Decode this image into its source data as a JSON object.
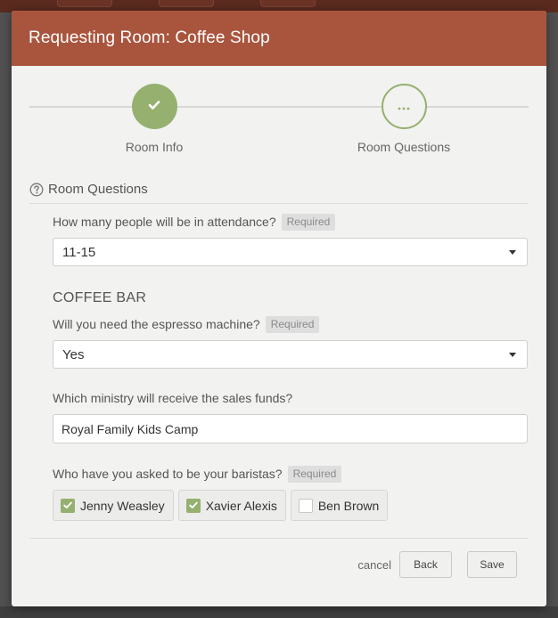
{
  "modal": {
    "title": "Requesting Room: Coffee Shop"
  },
  "stepper": {
    "steps": [
      {
        "label": "Room Info",
        "state": "completed",
        "icon": "check-icon"
      },
      {
        "label": "Room Questions",
        "state": "current",
        "icon": "ellipsis-icon"
      }
    ]
  },
  "section": {
    "title": "Room Questions",
    "icon": "help-circle-icon"
  },
  "questions": {
    "attendance": {
      "label": "How many people will be in attendance?",
      "badge": "Required",
      "value": "11-15"
    },
    "group_heading": "COFFEE BAR",
    "espresso": {
      "label": "Will you need the espresso machine?",
      "badge": "Required",
      "value": "Yes"
    },
    "ministry": {
      "label": "Which ministry will receive the sales funds?",
      "value": "Royal Family Kids Camp"
    },
    "baristas": {
      "label": "Who have you asked to be your baristas?",
      "badge": "Required",
      "options": [
        {
          "label": "Jenny Weasley",
          "checked": true
        },
        {
          "label": "Xavier Alexis",
          "checked": true
        },
        {
          "label": "Ben Brown",
          "checked": false
        }
      ]
    }
  },
  "footer": {
    "cancel_label": "cancel",
    "back_label": "Back",
    "save_label": "Save"
  },
  "colors": {
    "header": "#a9553e",
    "accent": "#95b06f"
  }
}
